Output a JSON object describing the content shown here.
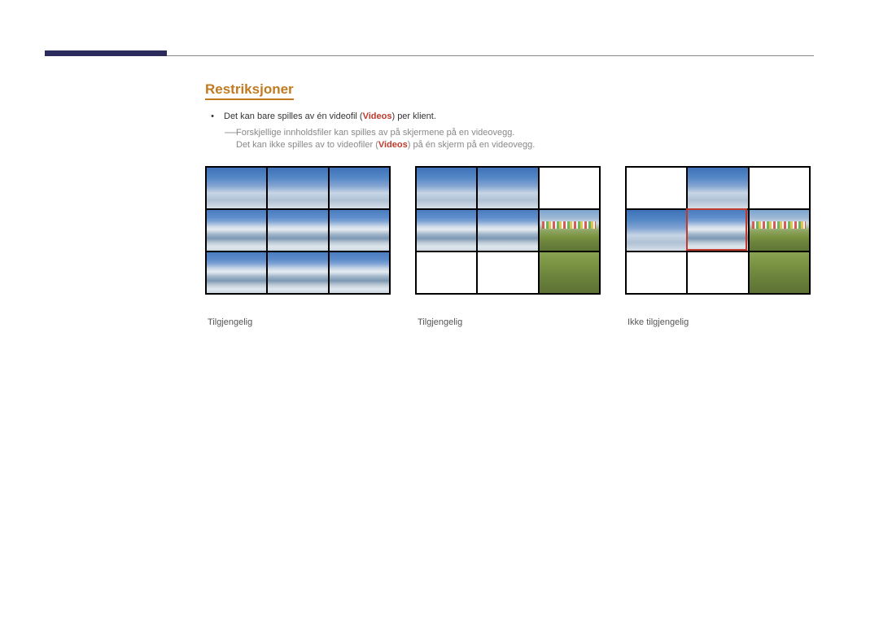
{
  "heading": "Restriksjoner",
  "bullet": {
    "prefix": "Det kan bare spilles av én videofil (",
    "videos_word": "Videos",
    "suffix": ") per klient."
  },
  "subline1": "Forskjellige innholdsfiler kan spilles av på skjermene på en videovegg.",
  "subline2": {
    "prefix": "Det kan ikke spilles av to videofiler (",
    "videos_word": "Videos",
    "suffix": ") på én skjerm på en videovegg."
  },
  "captions": {
    "c1": "Tilgjengelig",
    "c2": "Tilgjengelig",
    "c3": "Ikke tilgjengelig"
  }
}
